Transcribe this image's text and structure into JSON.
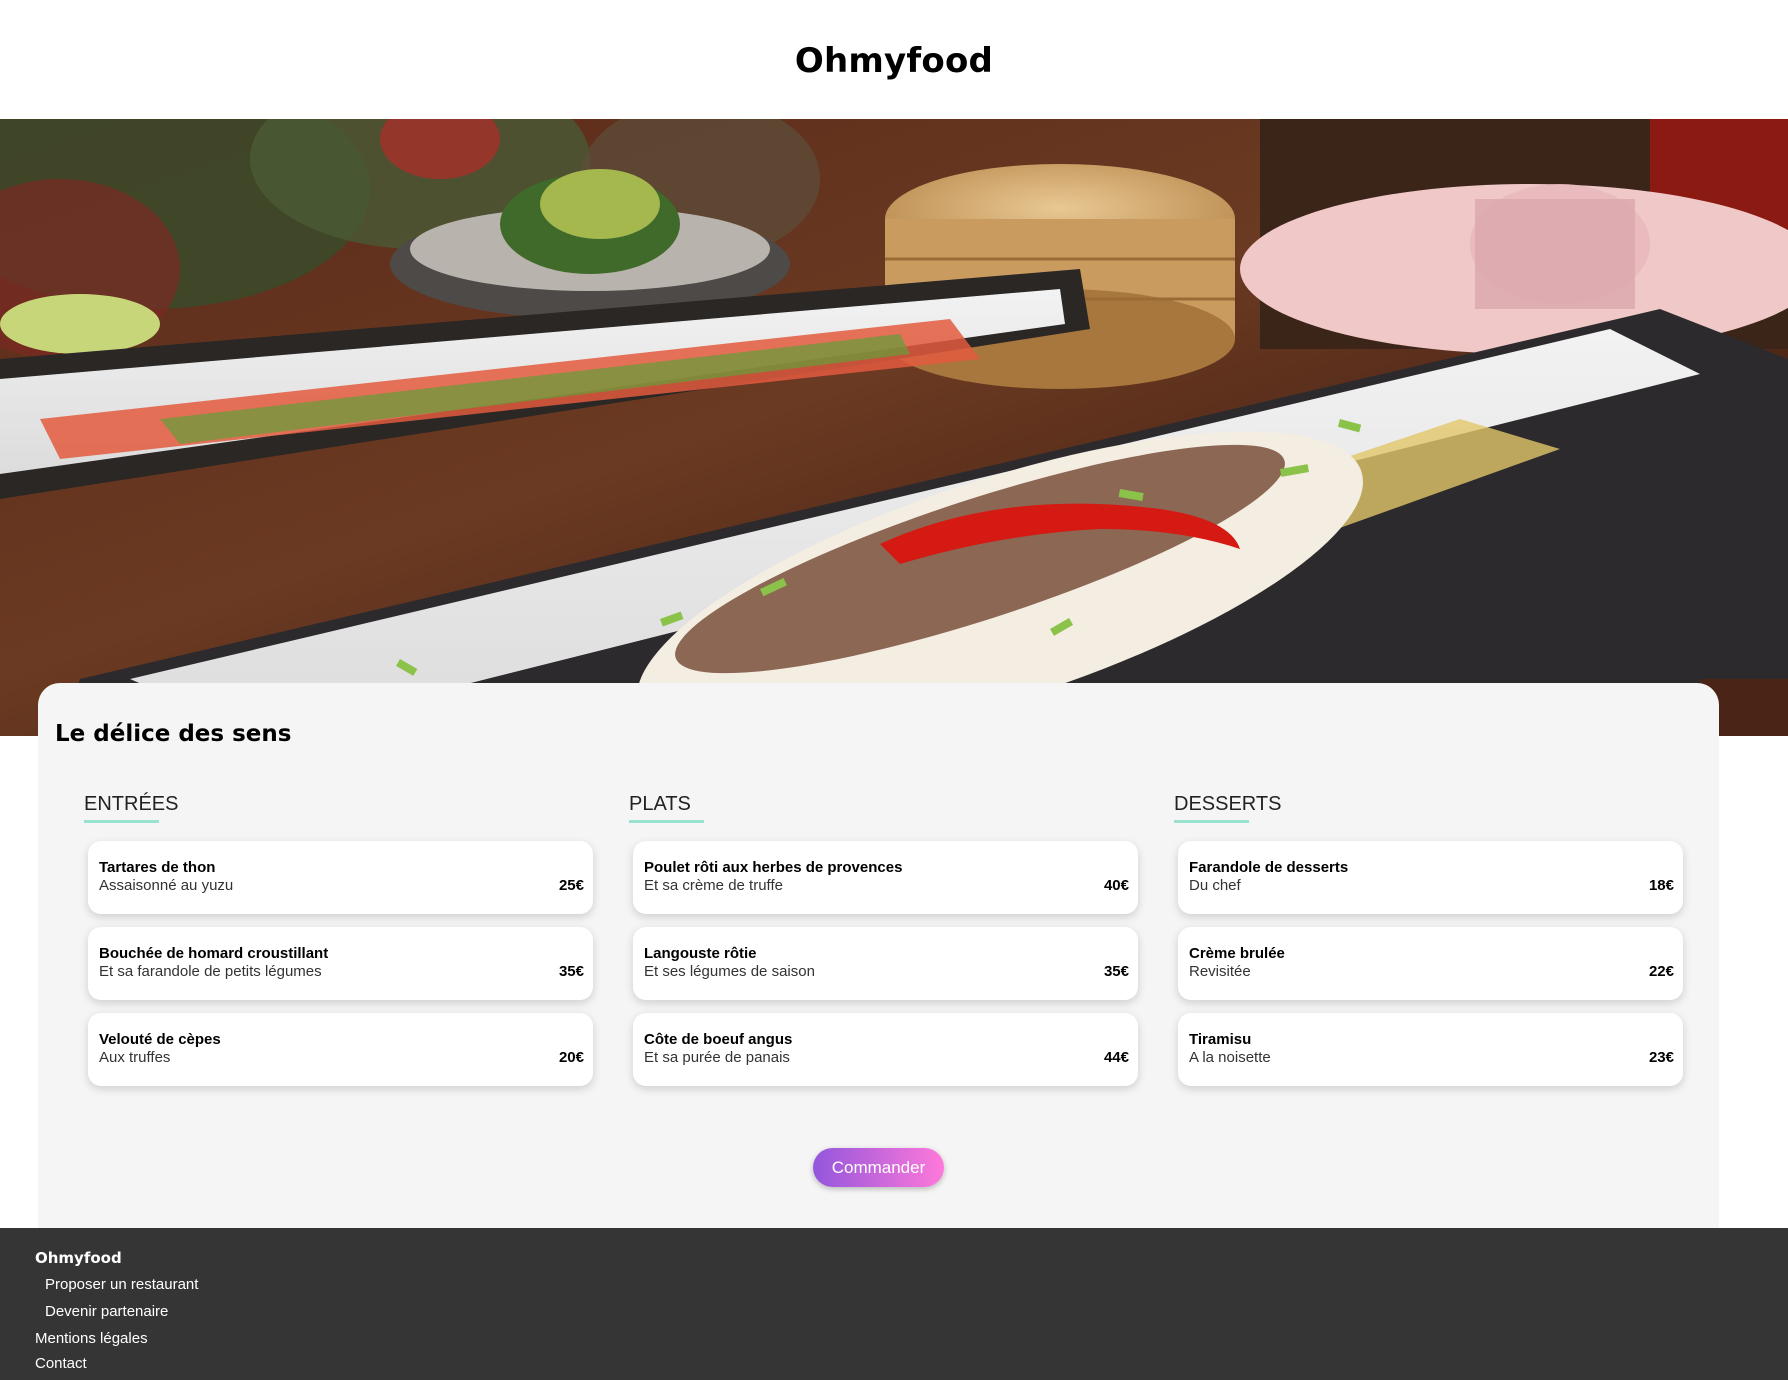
{
  "header": {
    "logo": "Ohmyfood"
  },
  "hero": {
    "image": "asian-food-dishes-photo"
  },
  "menu": {
    "title": "Le délice des sens",
    "columns": [
      {
        "heading": "ENTRÉES",
        "dishes": [
          {
            "name": "Tartares de thon",
            "desc": "Assaisonné au yuzu",
            "price": "25€"
          },
          {
            "name": "Bouchée de homard croustillant",
            "desc": "Et sa farandole de petits légumes",
            "price": "35€"
          },
          {
            "name": "Velouté de cèpes",
            "desc": "Aux truffes",
            "price": "20€"
          }
        ]
      },
      {
        "heading": "PLATS",
        "dishes": [
          {
            "name": "Poulet rôti aux herbes de provences",
            "desc": "Et sa crème de truffe",
            "price": "40€"
          },
          {
            "name": "Langouste rôtie",
            "desc": "Et ses légumes de saison",
            "price": "35€"
          },
          {
            "name": "Côte de boeuf angus",
            "desc": "Et sa purée de panais",
            "price": "44€"
          }
        ]
      },
      {
        "heading": "DESSERTS",
        "dishes": [
          {
            "name": "Farandole de desserts",
            "desc": "Du chef",
            "price": "18€"
          },
          {
            "name": "Crème brulée",
            "desc": "Revisitée",
            "price": "22€"
          },
          {
            "name": "Tiramisu",
            "desc": "A la noisette",
            "price": "23€"
          }
        ]
      }
    ],
    "order_button": "Commander"
  },
  "footer": {
    "logo": "Ohmyfood",
    "links": [
      "Proposer un restaurant",
      "Devenir partenaire",
      "Mentions légales",
      "Contact"
    ]
  },
  "colors": {
    "accent_underline": "#99e2d0",
    "button_gradient_start": "#9356dc",
    "button_gradient_end": "#ff79da",
    "footer_bg": "#353535",
    "card_bg": "#f5f5f5"
  }
}
